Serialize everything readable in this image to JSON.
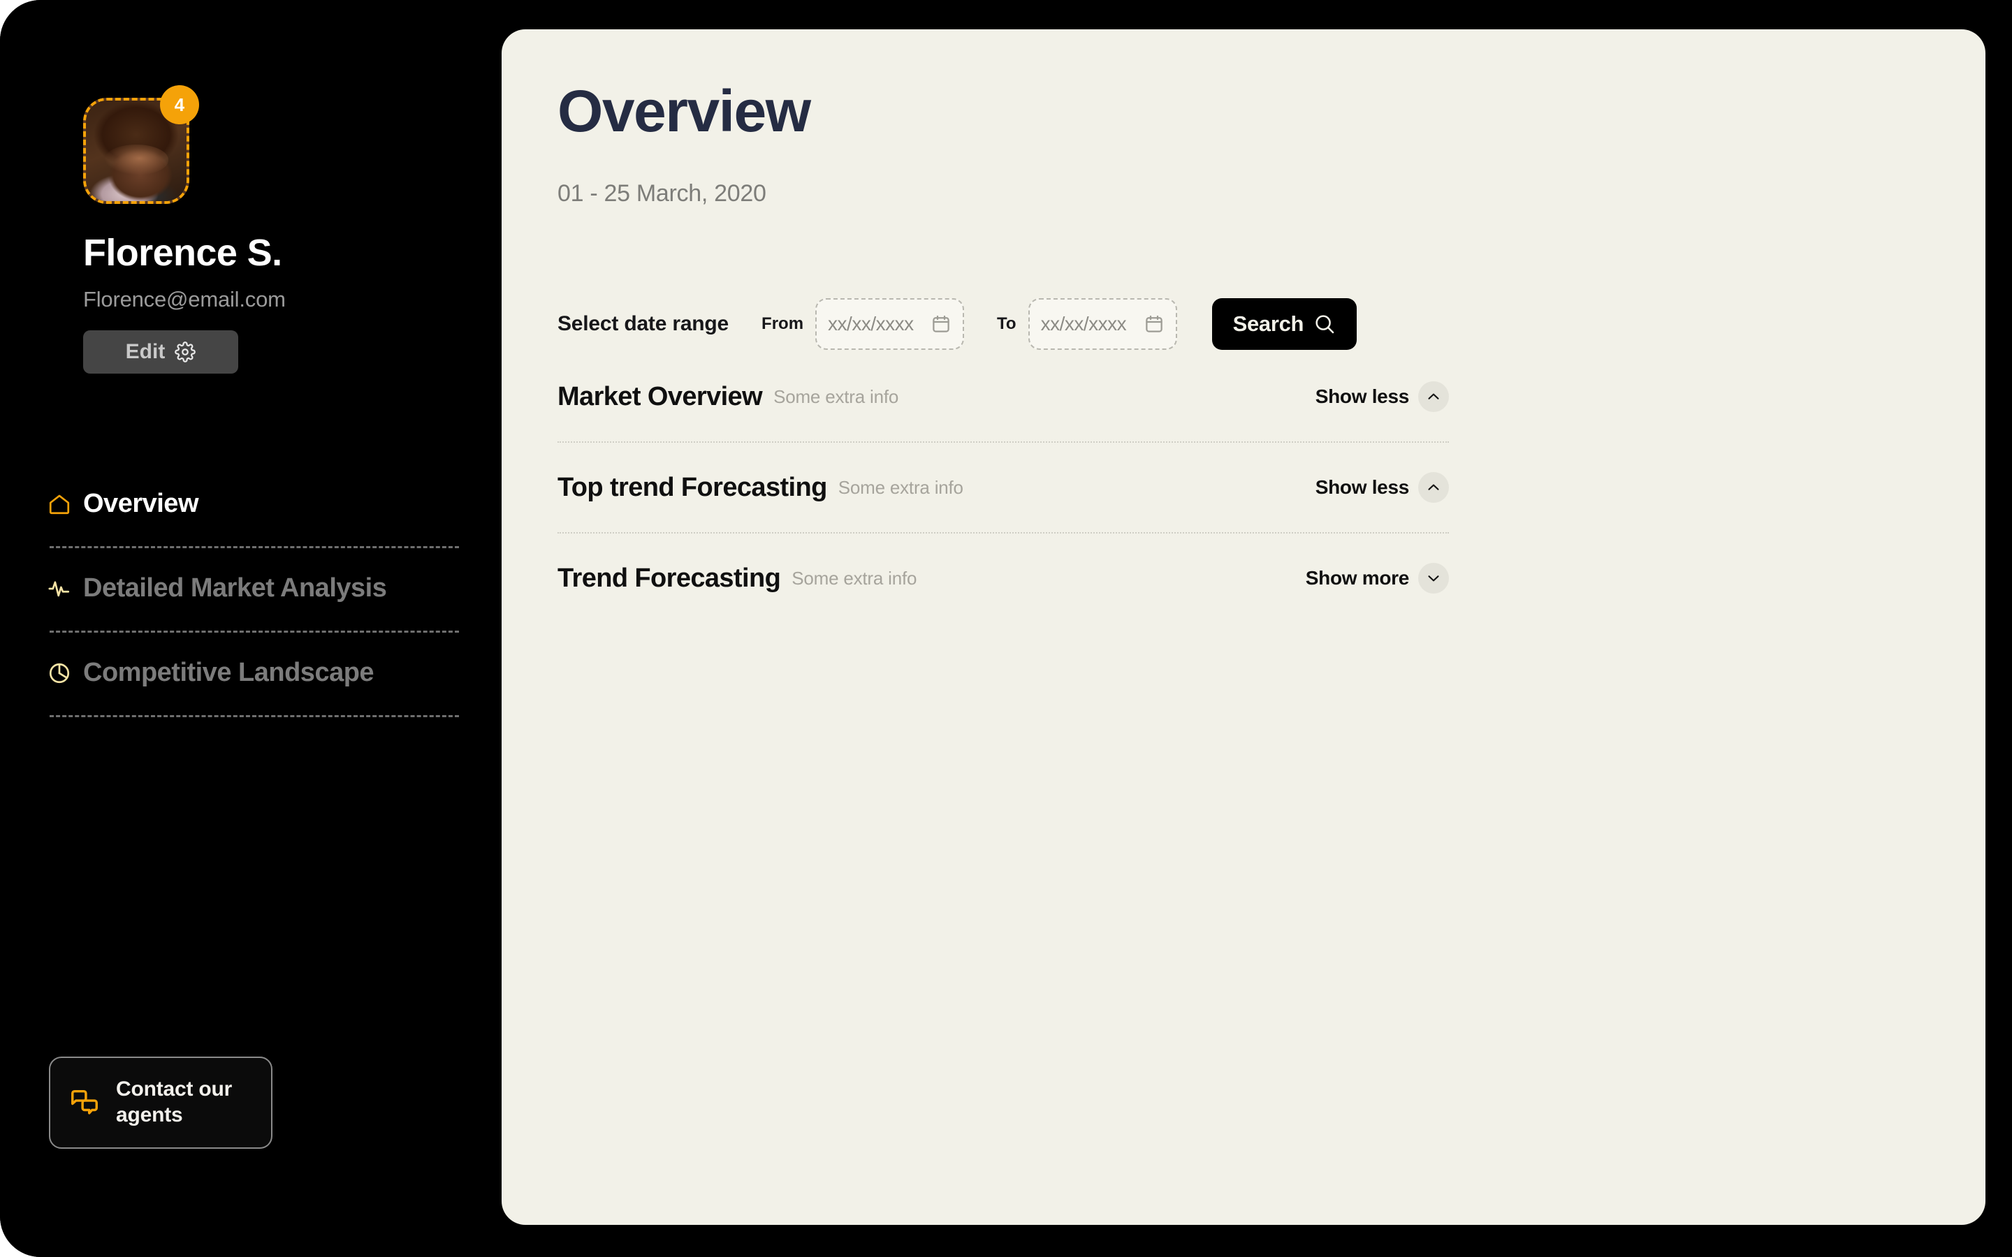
{
  "theme": {
    "accent": "#F5A209",
    "sidebar_bg": "#000000",
    "panel_bg": "#F2F1E8",
    "title_color": "#252C43",
    "muted_text": "#7d7d79"
  },
  "sidebar": {
    "profile": {
      "avatar_alt": "avatar",
      "badge_count": "4",
      "name": "Florence S.",
      "email": "Florence@email.com",
      "edit_label": "Edit"
    },
    "nav": {
      "items": [
        {
          "label": "Overview",
          "icon": "home-icon",
          "active": true
        },
        {
          "label": "Detailed Market Analysis",
          "icon": "activity-pulse-icon",
          "active": false
        },
        {
          "label": "Competitive Landscape",
          "icon": "pie-chart-icon",
          "active": false
        }
      ]
    },
    "contact": {
      "label": "Contact our agents",
      "icon": "chat-bubbles-icon"
    }
  },
  "main": {
    "title": "Overview",
    "subtitle": "01 - 25 March, 2020",
    "daterange": {
      "label": "Select date range",
      "from_prefix": "From",
      "from_value": "",
      "from_placeholder": "xx/xx/xxxx",
      "to_prefix": "To",
      "to_value": "",
      "to_placeholder": "xx/xx/xxxx",
      "search_label": "Search",
      "search_icon": "magnifier-icon",
      "calendar_icon": "calendar-icon"
    },
    "accordion": {
      "rows": [
        {
          "title": "Market Overview",
          "extra": "Some extra info",
          "toggle_label": "Show less",
          "toggle_icon": "chevron-up-icon",
          "expanded": true
        },
        {
          "title": "Top trend Forecasting",
          "extra": "Some extra info",
          "toggle_label": "Show less",
          "toggle_icon": "chevron-up-icon",
          "expanded": true
        },
        {
          "title": "Trend Forecasting",
          "extra": "Some extra info",
          "toggle_label": "Show more",
          "toggle_icon": "chevron-down-icon",
          "expanded": false
        }
      ]
    }
  }
}
